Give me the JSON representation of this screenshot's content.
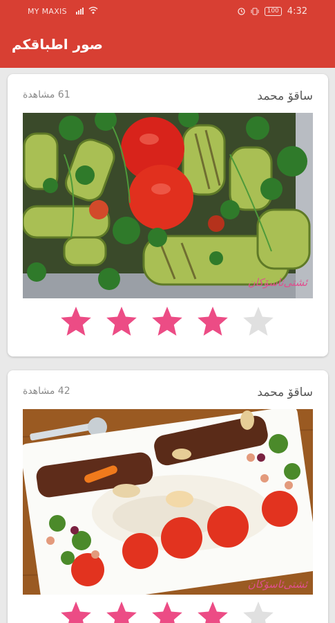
{
  "status_bar": {
    "carrier": "MY MAXIS",
    "battery": "100",
    "time": "4:32"
  },
  "app_bar": {
    "title": "صور اطباقكم"
  },
  "posts": [
    {
      "author": "ساقۆ محمد",
      "views": "61 مشاهدة",
      "photo": "grilled-zucchini-tomatoes",
      "watermark": "ئشتی‌ئاسۆکان",
      "rating": 4,
      "max_rating": 5
    },
    {
      "author": "ساقۆ محمد",
      "views": "42 مشاهدة",
      "photo": "kebab-with-rice-platter",
      "watermark": "ئشتی‌ئاسۆکان",
      "rating": 4,
      "max_rating": 5
    }
  ],
  "colors": {
    "app_bar": "#d83f33",
    "star_on": "#ec4c85",
    "star_off": "#e0e0e0"
  }
}
